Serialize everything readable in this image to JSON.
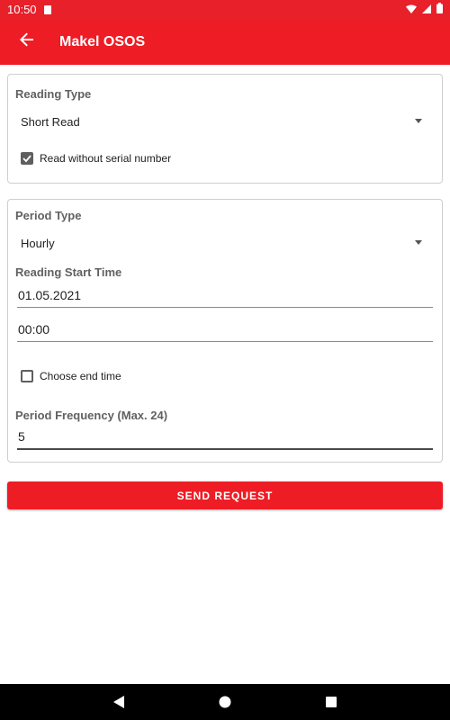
{
  "status_bar": {
    "time": "10:50",
    "icons": [
      "sd-card-icon",
      "wifi-icon",
      "signal-icon",
      "battery-icon"
    ]
  },
  "app_bar": {
    "title": "Makel OSOS",
    "back_icon": "arrow-back-icon"
  },
  "reading_section": {
    "label": "Reading Type",
    "selected": "Short Read",
    "checkbox_label": "Read without serial number",
    "checkbox_checked": true
  },
  "period_section": {
    "period_type_label": "Period Type",
    "period_type_selected": "Hourly",
    "start_time_label": "Reading Start Time",
    "start_date_value": "01.05.2021",
    "start_time_value": "00:00",
    "end_time_checkbox_label": "Choose end time",
    "end_time_checked": false,
    "frequency_label": "Period Frequency (Max. 24)",
    "frequency_value": "5"
  },
  "actions": {
    "send_label": "SEND REQUEST"
  },
  "nav_bar": {
    "icons": [
      "nav-back-icon",
      "nav-home-icon",
      "nav-recents-icon"
    ]
  },
  "colors": {
    "primary": "#ee1c25",
    "status_bar": "#e8202a",
    "checkbox": "#5f5f5f"
  }
}
